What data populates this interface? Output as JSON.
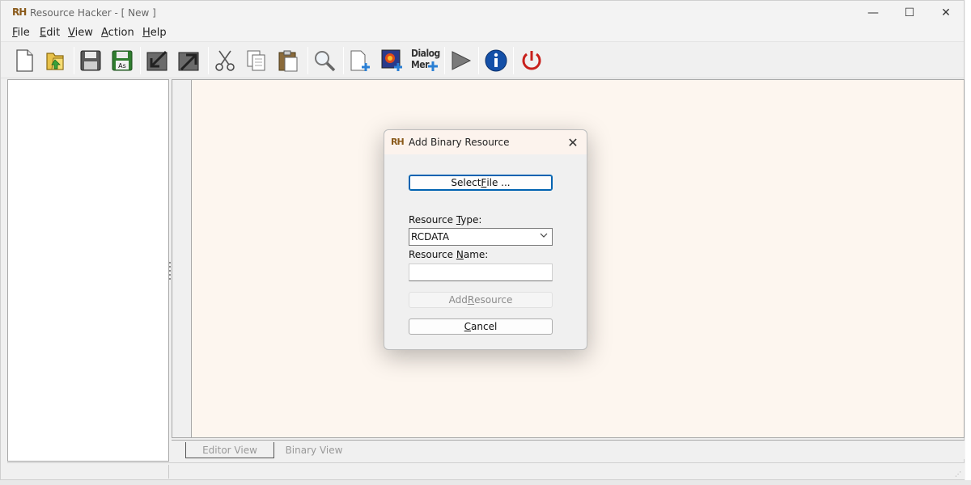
{
  "window": {
    "app_icon": "RH",
    "title": "Resource Hacker - [ New ]",
    "minimize_glyph": "—",
    "maximize_glyph": "☐",
    "close_glyph": "✕"
  },
  "menu": [
    {
      "key": "F",
      "rest": "ile"
    },
    {
      "key": "E",
      "rest": "dit"
    },
    {
      "key": "V",
      "rest": "iew"
    },
    {
      "key": "A",
      "rest": "ction"
    },
    {
      "key": "H",
      "rest": "elp"
    }
  ],
  "toolbar": {
    "icons": [
      "new-file-icon",
      "open-folder-icon",
      "save-icon",
      "save-as-icon",
      "import-icon",
      "export-icon",
      "cut-icon",
      "copy-icon",
      "paste-icon",
      "find-icon",
      "add-resource-icon",
      "add-image-icon",
      "dialog-menu-icon",
      "run-script-icon",
      "info-icon",
      "exit-icon"
    ],
    "save_as_text": "As",
    "dialog_menu_line1": "Dialog",
    "dialog_menu_line2": "Mer"
  },
  "tabs": {
    "editor_view": "Editor View",
    "binary_view": "Binary View"
  },
  "dialog": {
    "icon": "RH",
    "title": "Add Binary Resource",
    "close_glyph": "✕",
    "select_file_pre": "Select ",
    "select_file_key": "F",
    "select_file_post": "ile ...",
    "resource_type_pre": "Resource ",
    "resource_type_key": "T",
    "resource_type_post": "ype:",
    "resource_type_value": "RCDATA",
    "resource_name_pre": "Resource ",
    "resource_name_key": "N",
    "resource_name_post": "ame:",
    "resource_name_value": "",
    "add_resource_pre": "Add ",
    "add_resource_key": "R",
    "add_resource_post": "esource",
    "cancel_key": "C",
    "cancel_post": "ancel"
  },
  "colors": {
    "editor_background": "#fdf6ef",
    "primary_button_border": "#0063b1",
    "exit_red": "#c8201c",
    "info_blue": "#1450a8"
  }
}
